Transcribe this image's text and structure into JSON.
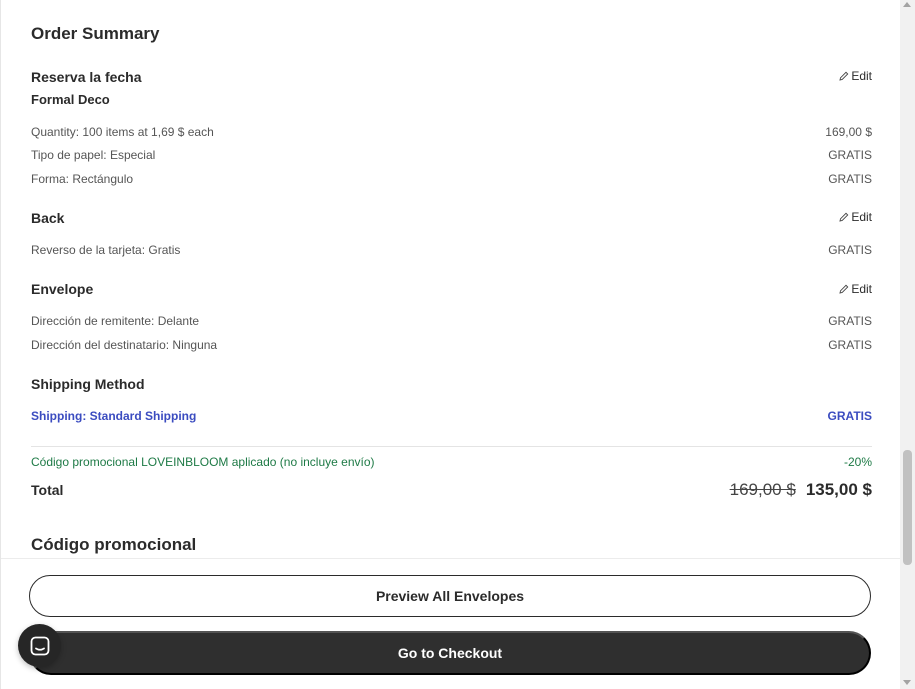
{
  "summary": {
    "title": "Order Summary",
    "edit_label": "Edit",
    "product": {
      "name": "Reserva la fecha",
      "variant": "Formal Deco",
      "rows": [
        {
          "label": "Quantity: 100 items at 1,69 $ each",
          "value": "169,00 $"
        },
        {
          "label": "Tipo de papel: Especial",
          "value": "GRATIS"
        },
        {
          "label": "Forma: Rectángulo",
          "value": "GRATIS"
        }
      ]
    },
    "back": {
      "name": "Back",
      "rows": [
        {
          "label": "Reverso de la tarjeta: Gratis",
          "value": "GRATIS"
        }
      ]
    },
    "envelope": {
      "name": "Envelope",
      "rows": [
        {
          "label": "Dirección de remitente: Delante",
          "value": "GRATIS"
        },
        {
          "label": "Dirección del destinatario: Ninguna",
          "value": "GRATIS"
        }
      ]
    },
    "shipping": {
      "name": "Shipping Method",
      "label": "Shipping: Standard Shipping",
      "value": "GRATIS"
    },
    "promo": {
      "label": "Código promocional LOVEINBLOOM aplicado (no incluye envío)",
      "value": "-20%"
    },
    "total": {
      "label": "Total",
      "old_price": "169,00 $",
      "new_price": "135,00 $"
    },
    "promo_section_title": "Código promocional"
  },
  "footer": {
    "preview_label": "Preview All Envelopes",
    "checkout_label": "Go to Checkout"
  },
  "colors": {
    "shipping": "#3b4cc0",
    "promo": "#1e7a46",
    "checkout_bg": "#2f2f2f"
  },
  "icons": {
    "edit": "pencil-icon",
    "chat": "chat-icon"
  }
}
